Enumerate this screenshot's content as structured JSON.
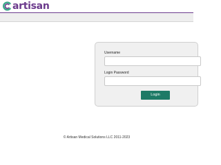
{
  "header": {
    "logo_text": "artisan",
    "logo_icon": "artisan-swirl-logo",
    "brand_color": "#6b3a8c"
  },
  "login": {
    "username_label": "Username",
    "username_value": "",
    "password_label": "Login Password",
    "password_value": "",
    "button_label": "Login",
    "button_color": "#1d7a66"
  },
  "footer": {
    "copyright": "© Artisan Medical Solutions LLC 2011-2023"
  }
}
